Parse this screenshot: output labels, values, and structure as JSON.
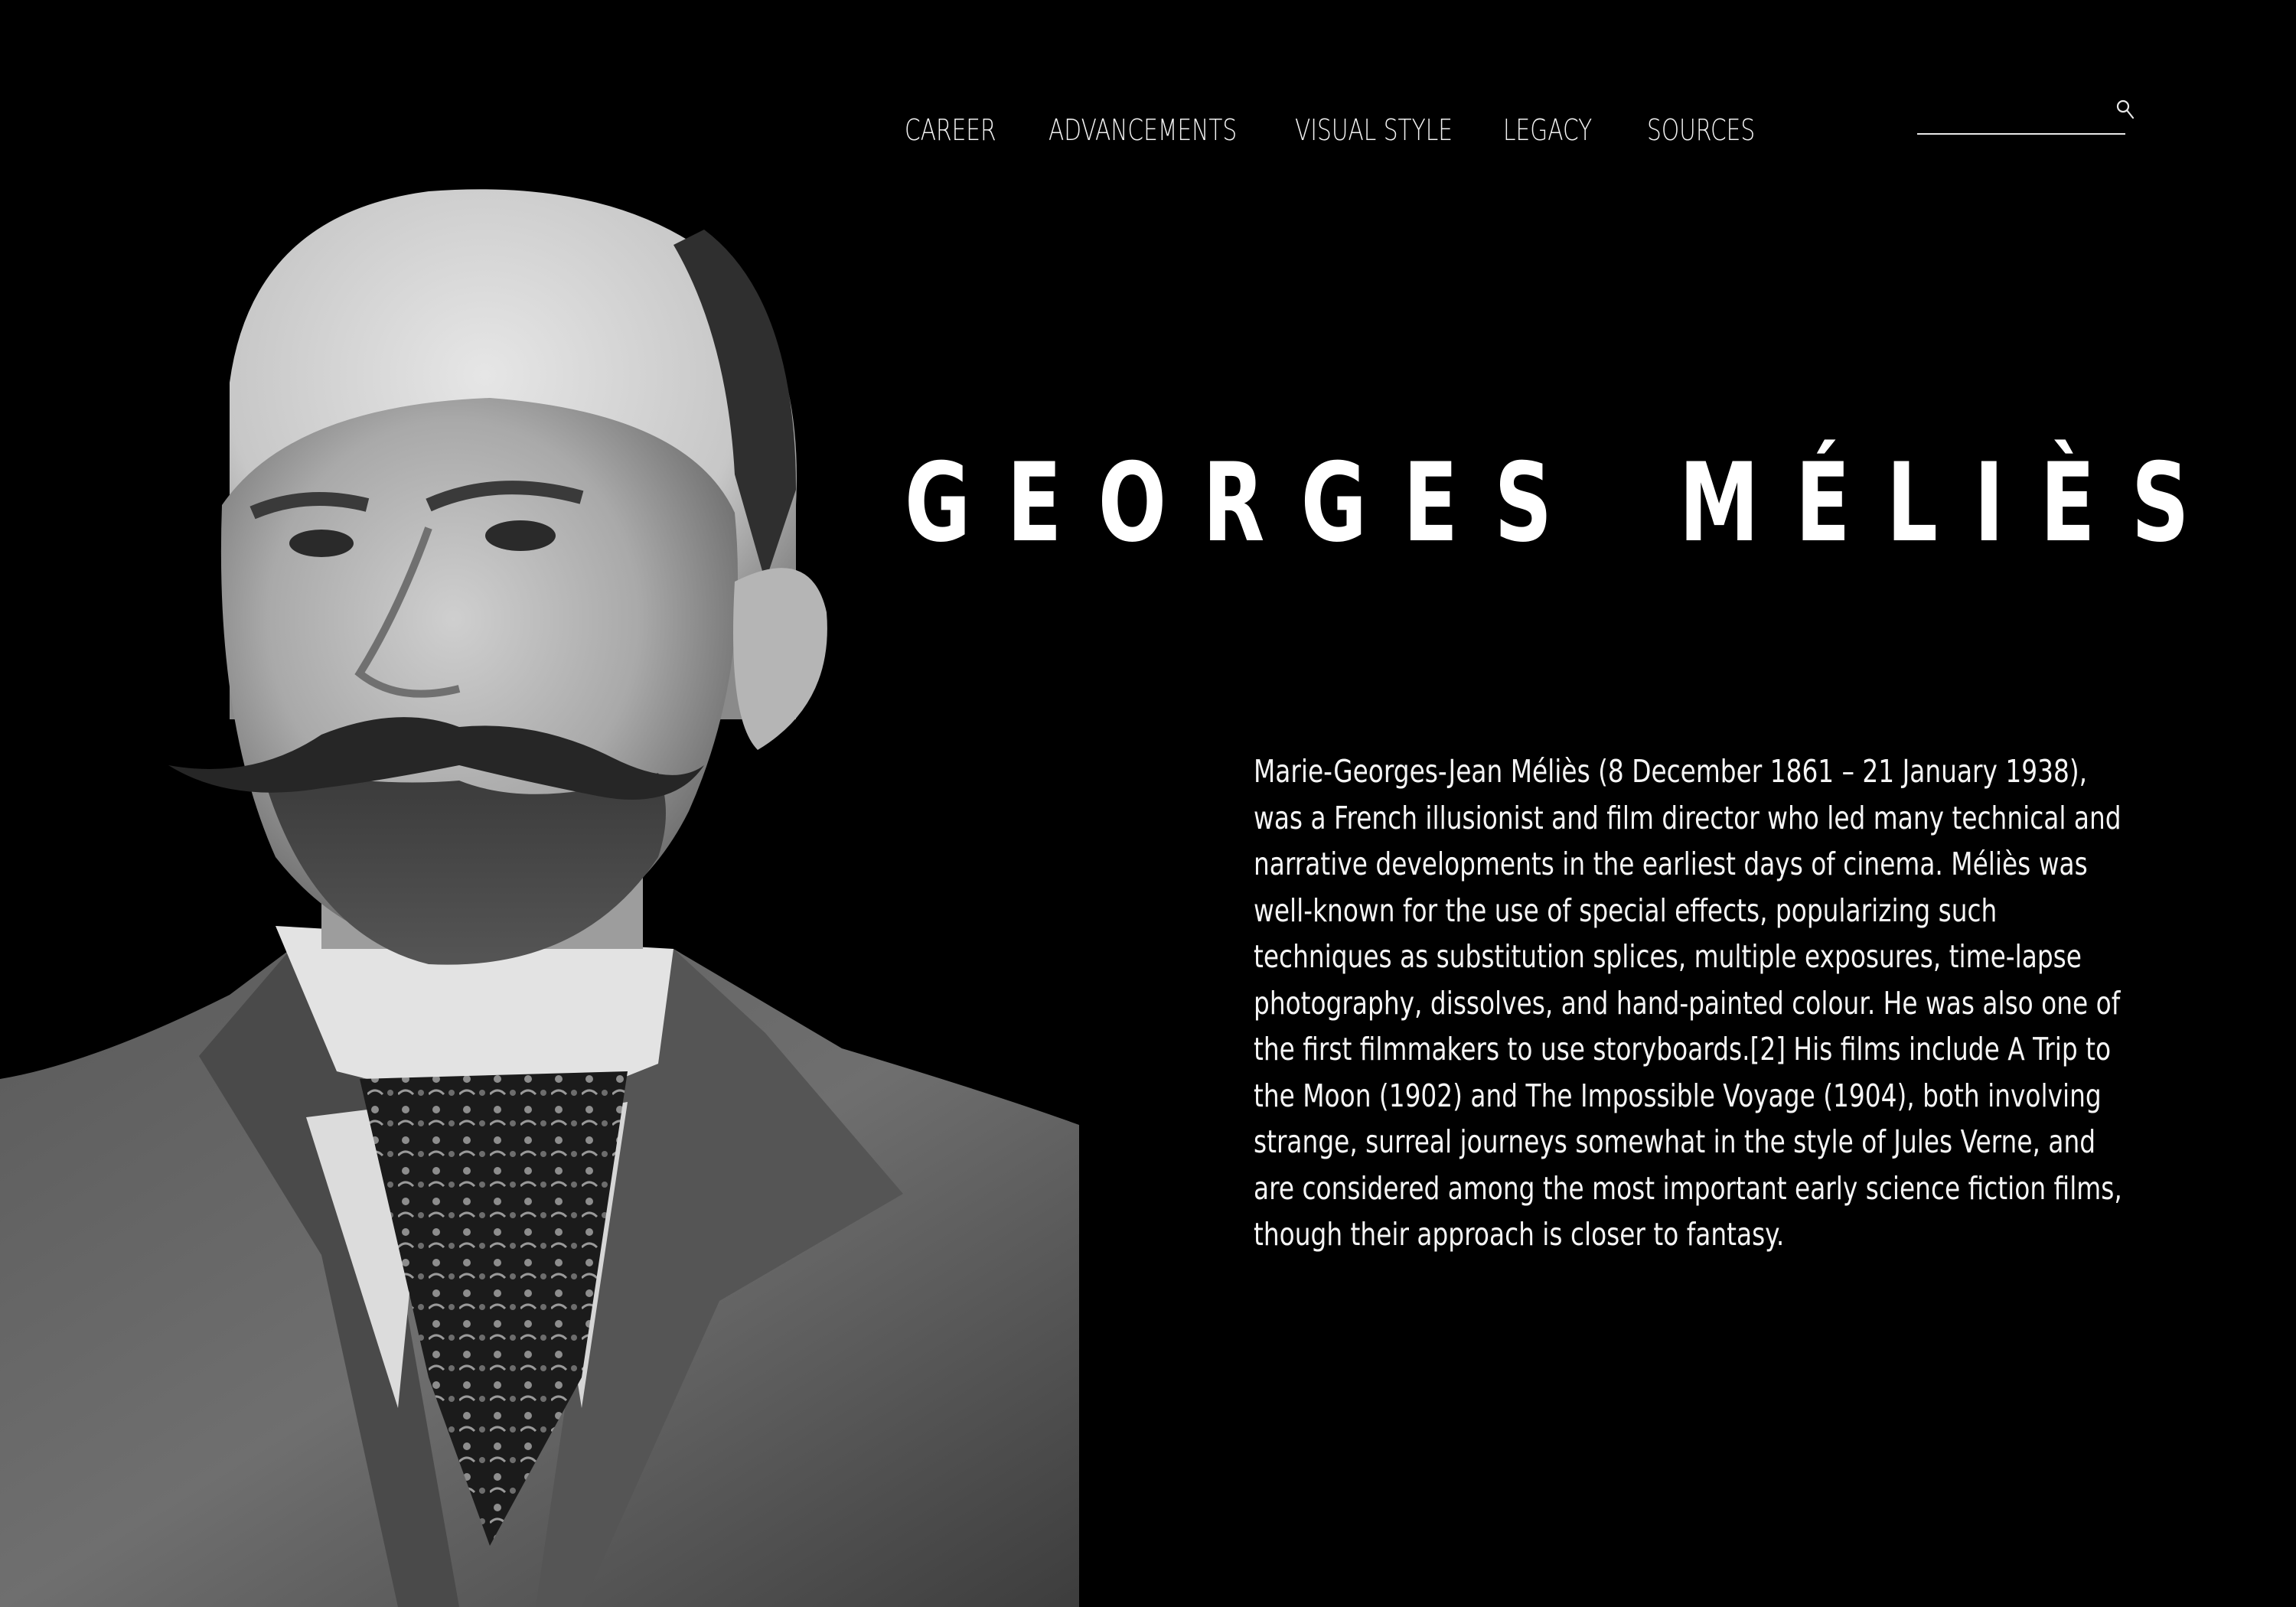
{
  "nav": {
    "items": [
      {
        "label": "CAREER"
      },
      {
        "label": "ADVANCEMENTS"
      },
      {
        "label": "VISUAL STYLE"
      },
      {
        "label": "LEGACY"
      },
      {
        "label": "SOURCES"
      }
    ]
  },
  "search": {
    "placeholder": "",
    "value": "",
    "icon": "search-icon"
  },
  "hero": {
    "title_first": "GEORGES",
    "title_last": "MÉLIÈS",
    "portrait_icon": "portrait-photo"
  },
  "bio": {
    "text": "Marie-Georges-Jean Méliès (8 December 1861 – 21 January 1938), was a French illusionist and film director who led many technical and narrative developments in the earliest days of cinema. Méliès was well-known for the use of special effects, popularizing such techniques as substitution splices, multiple exposures, time-lapse photography, dissolves, and hand-painted colour. He was also one of the first filmmakers to use storyboards.[2] His films include A Trip to the Moon (1902) and The Impossible Voyage (1904), both involving strange, surreal journeys somewhat in the style of Jules Verne, and are considered among the most important early science fiction films, though their approach is closer to fantasy."
  },
  "colors": {
    "background": "#000000",
    "text": "#ffffff"
  }
}
